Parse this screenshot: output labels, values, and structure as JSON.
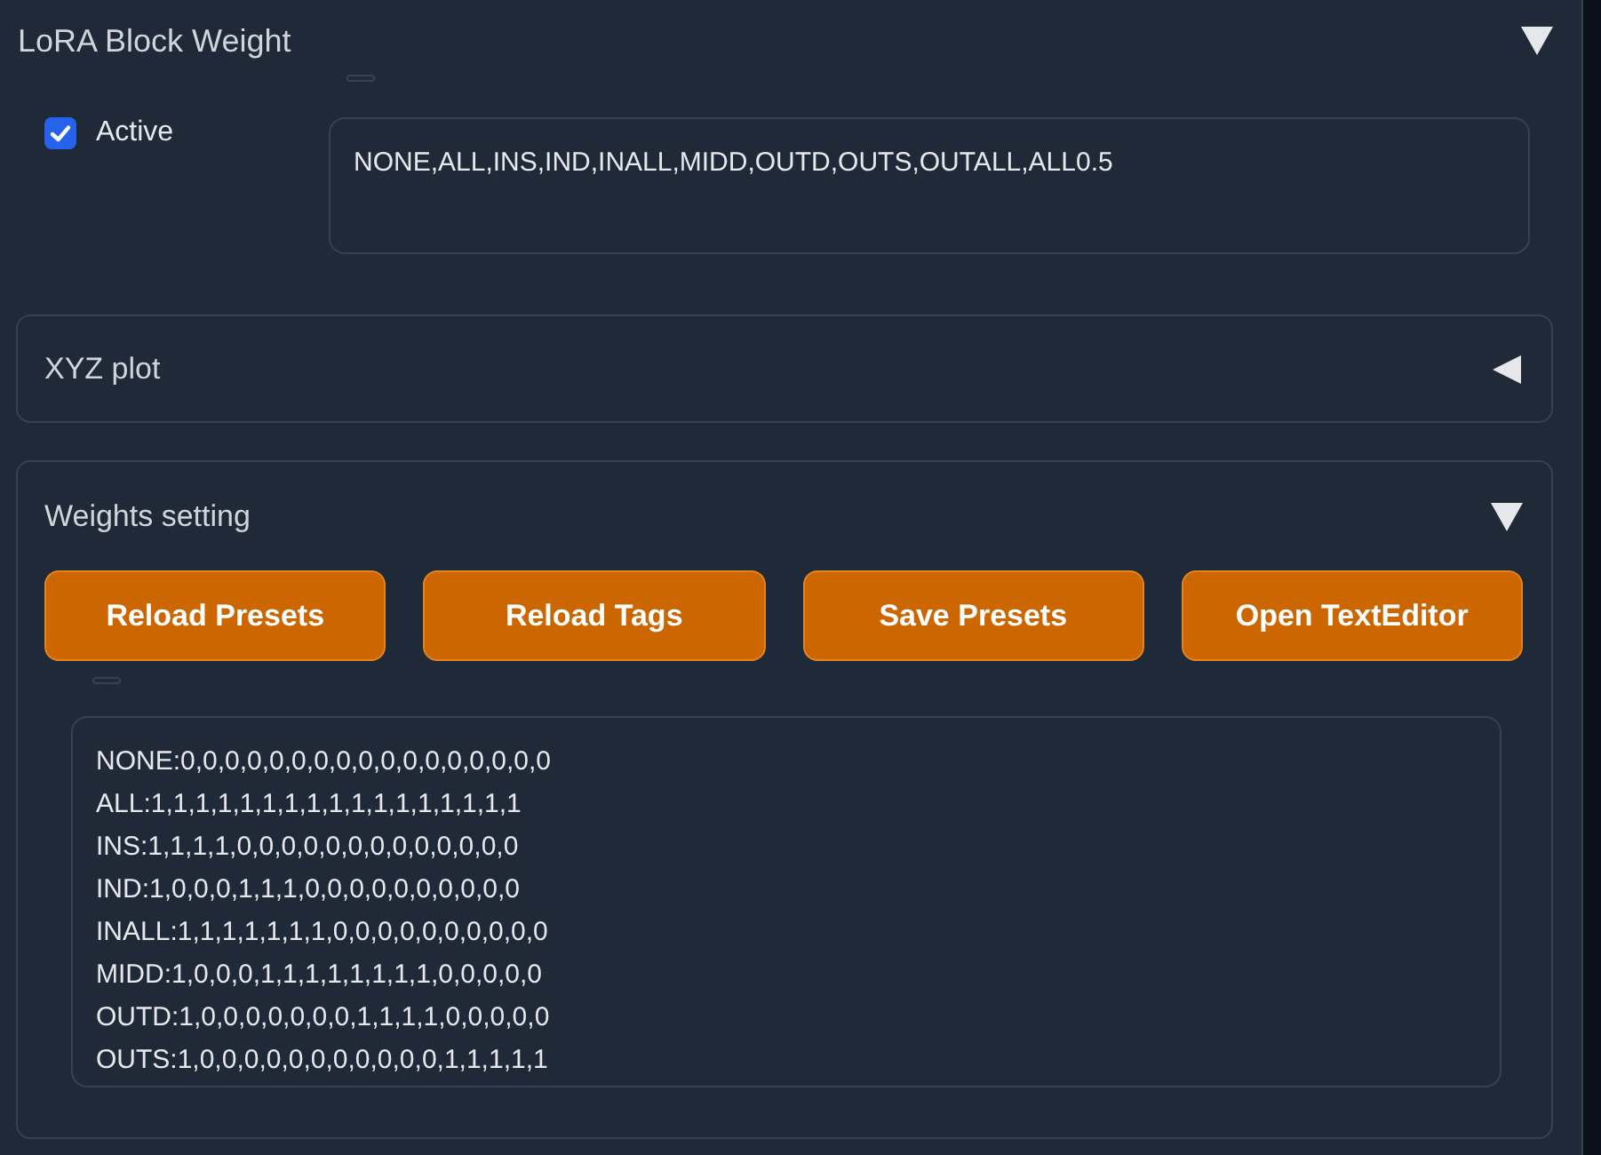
{
  "panel": {
    "title": "LoRA Block Weight",
    "expanded": true
  },
  "active": {
    "label": "Active",
    "checked": true
  },
  "preset_field": {
    "value": "NONE,ALL,INS,IND,INALL,MIDD,OUTD,OUTS,OUTALL,ALL0.5"
  },
  "sections": [
    {
      "title": "XYZ plot",
      "expanded": false
    },
    {
      "title": "Weights setting",
      "expanded": true,
      "buttons": [
        "Reload Presets",
        "Reload Tags",
        "Save Presets",
        "Open TextEditor"
      ],
      "editor": {
        "lines": [
          "NONE:0,0,0,0,0,0,0,0,0,0,0,0,0,0,0,0,0",
          "ALL:1,1,1,1,1,1,1,1,1,1,1,1,1,1,1,1,1",
          "INS:1,1,1,1,0,0,0,0,0,0,0,0,0,0,0,0,0",
          "IND:1,0,0,0,1,1,1,0,0,0,0,0,0,0,0,0,0",
          "INALL:1,1,1,1,1,1,1,0,0,0,0,0,0,0,0,0,0",
          "MIDD:1,0,0,0,1,1,1,1,1,1,1,1,0,0,0,0,0",
          "OUTD:1,0,0,0,0,0,0,0,1,1,1,1,0,0,0,0,0",
          "OUTS:1,0,0,0,0,0,0,0,0,0,0,0,1,1,1,1,1"
        ]
      }
    }
  ]
}
